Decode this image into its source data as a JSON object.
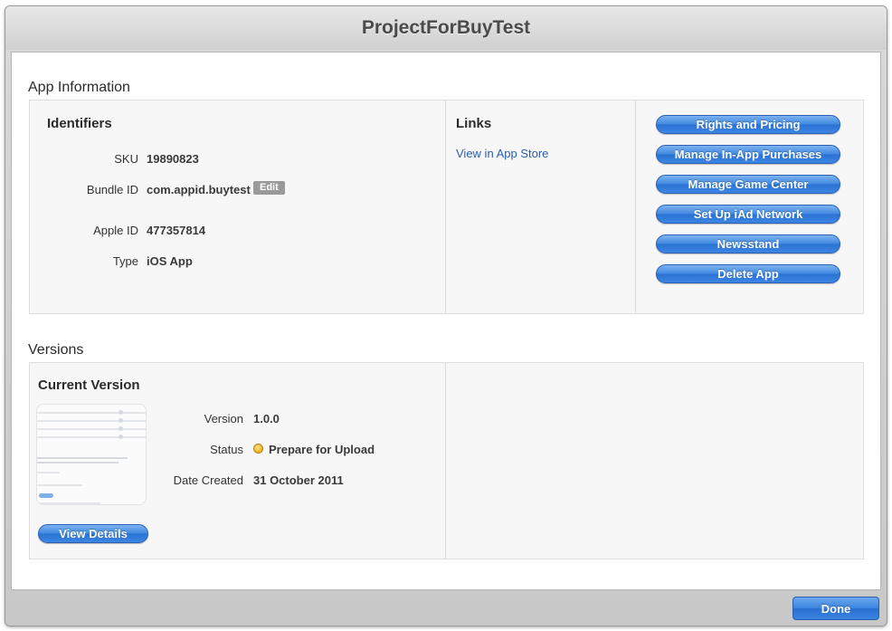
{
  "window": {
    "title": "ProjectForBuyTest"
  },
  "app_info": {
    "heading": "App Information",
    "identifiers": {
      "title": "Identifiers",
      "sku_label": "SKU",
      "sku_value": "19890823",
      "bundle_label": "Bundle ID",
      "bundle_value": "com.appid.buytest",
      "edit_label": "Edit",
      "appleid_label": "Apple ID",
      "appleid_value": "477357814",
      "type_label": "Type",
      "type_value": "iOS App"
    },
    "links": {
      "title": "Links",
      "view_in_store": "View in App Store"
    },
    "actions": [
      "Rights and Pricing",
      "Manage In-App Purchases",
      "Manage Game Center",
      "Set Up iAd Network",
      "Newsstand",
      "Delete App"
    ]
  },
  "versions": {
    "heading": "Versions",
    "current": {
      "title": "Current Version",
      "version_label": "Version",
      "version_value": "1.0.0",
      "status_label": "Status",
      "status_value": "Prepare for Upload",
      "status_icon": "status-yellow-icon",
      "date_label": "Date Created",
      "date_value": "31 October 2011",
      "view_details": "View Details"
    }
  },
  "footer": {
    "done_label": "Done"
  },
  "colors": {
    "accent_blue": "#3a85e2",
    "link_blue": "#2a5db0",
    "status_yellow": "#f2b01e"
  }
}
